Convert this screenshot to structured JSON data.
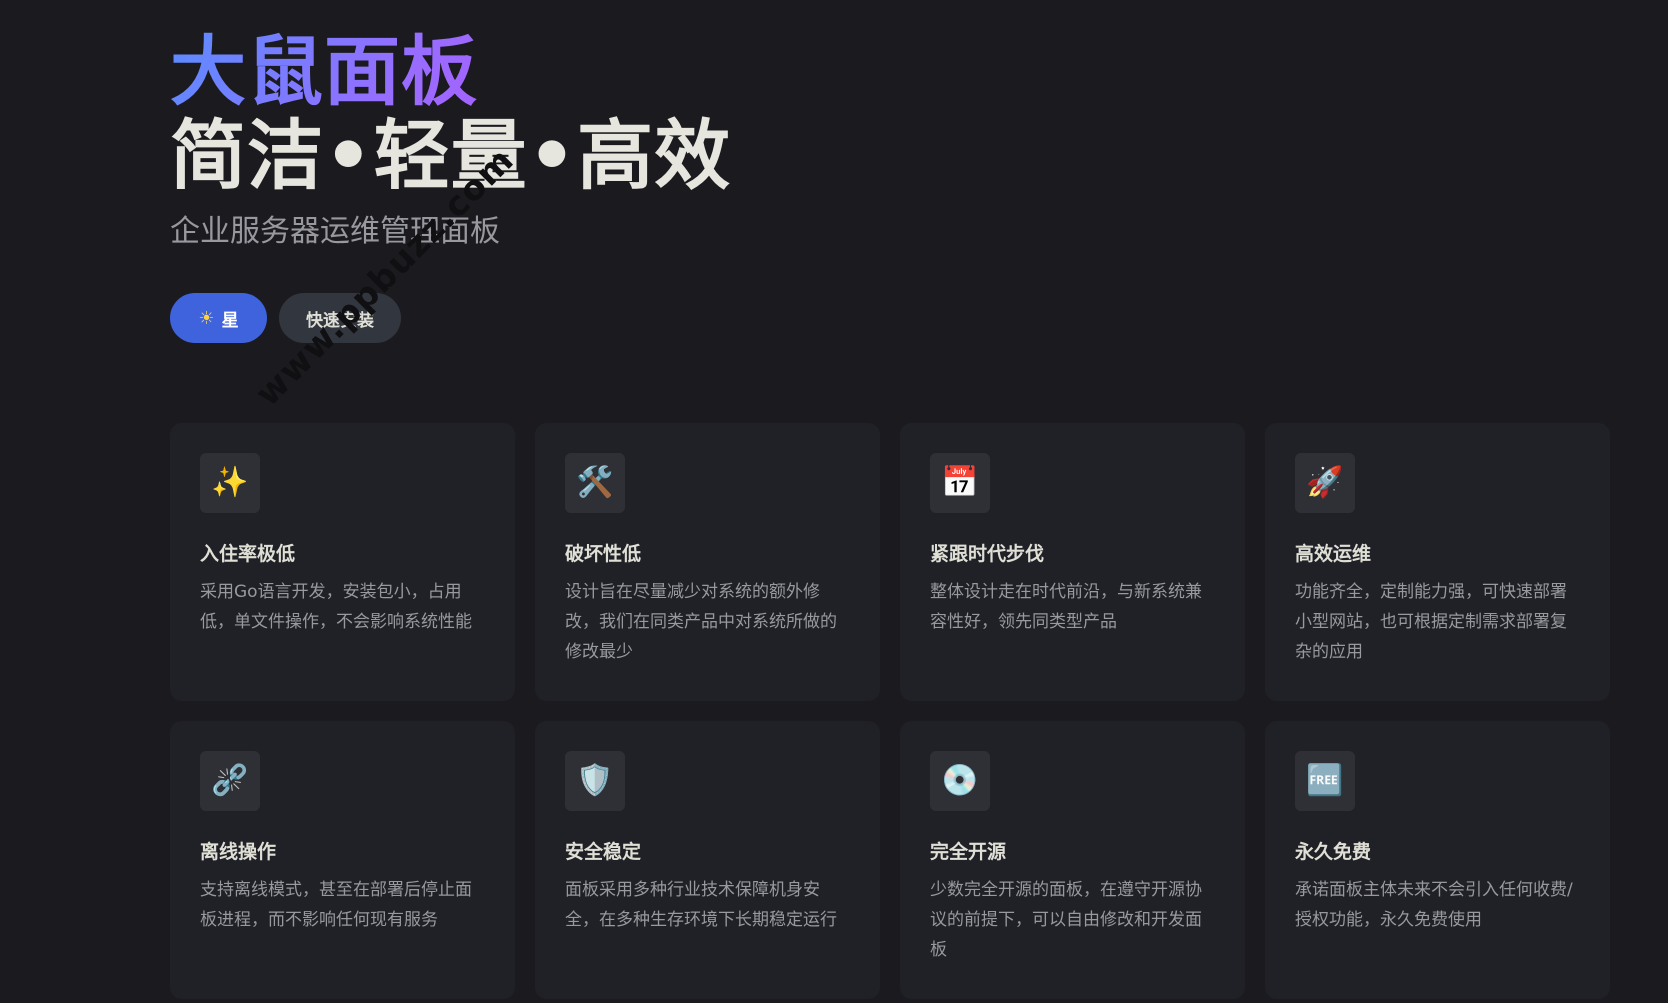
{
  "hero": {
    "name": "大鼠面板",
    "text": "简洁•轻量•高效",
    "tagline": "企业服务器运维管理面板"
  },
  "actions": {
    "star_label": "星",
    "star_icon": "sun-icon",
    "install_label": "快速安装"
  },
  "watermark": "www.ppbuzz.com",
  "features": [
    {
      "icon": "✨",
      "icon_name": "sparkles-icon",
      "title": "入住率极低",
      "details": "采用Go语言开发，安装包小，占用低，单文件操作，不会影响系统性能"
    },
    {
      "icon": "🛠️",
      "icon_name": "tools-icon",
      "title": "破坏性低",
      "details": "设计旨在尽量减少对系统的额外修改，我们在同类产品中对系统所做的修改最少"
    },
    {
      "icon": "📅",
      "icon_name": "calendar-icon",
      "title": "紧跟时代步伐",
      "details": "整体设计走在时代前沿，与新系统兼容性好，领先同类型产品"
    },
    {
      "icon": "🚀",
      "icon_name": "rocket-icon",
      "title": "高效运维",
      "details": "功能齐全，定制能力强，可快速部署小型网站，也可根据定制需求部署复杂的应用"
    },
    {
      "icon": "⛓️‍💥",
      "icon_name": "broken-chain-icon",
      "title": "离线操作",
      "details": "支持离线模式，甚至在部署后停止面板进程，而不影响任何现有服务"
    },
    {
      "icon": "🛡️",
      "icon_name": "shield-icon",
      "title": "安全稳定",
      "details": "面板采用多种行业技术保障机身安全，在多种生存环境下长期稳定运行"
    },
    {
      "icon": "💿",
      "icon_name": "disc-icon",
      "title": "完全开源",
      "details": "少数完全开源的面板，在遵守开源协议的前提下，可以自由修改和开发面板"
    },
    {
      "icon": "🆓",
      "icon_name": "free-icon",
      "title": "永久免费",
      "details": "承诺面板主体未来不会引入任何收费/授权功能，永久免费使用"
    }
  ]
}
